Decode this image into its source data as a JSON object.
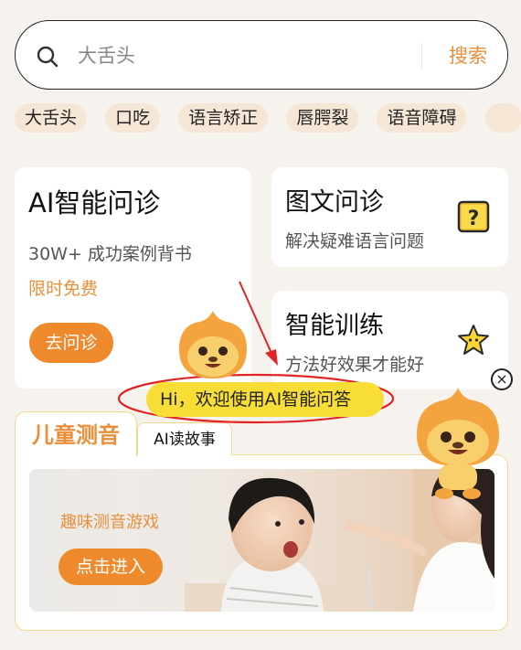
{
  "search": {
    "placeholder": "大舌头",
    "button_label": "搜索"
  },
  "tags": [
    "大舌头",
    "口吃",
    "语言矫正",
    "唇腭裂",
    "语音障碍"
  ],
  "cards": {
    "ai": {
      "title": "AI智能问诊",
      "subtitle": "30W+ 成功案例背书",
      "promo": "限时免费",
      "button_label": "去问诊"
    },
    "image_text": {
      "title": "图文问诊",
      "subtitle": "解决疑难语言问题",
      "icon": "question-block-icon"
    },
    "training": {
      "title": "智能训练",
      "subtitle": "方法好效果才能好",
      "icon": "star-icon"
    }
  },
  "tabs": {
    "active": "儿童测音",
    "secondary": "AI读故事"
  },
  "banner": {
    "text": "趣味测音游戏",
    "button_label": "点击进入"
  },
  "overlay": {
    "greeting": "Hi，欢迎使用AI智能问答",
    "close_symbol": "×"
  },
  "colors": {
    "accent": "#ee8a2c",
    "accent_text": "#e98f3a",
    "background": "#f6f3ef",
    "greeting_bg": "#f7dd35",
    "annotation_red": "#e12424"
  }
}
